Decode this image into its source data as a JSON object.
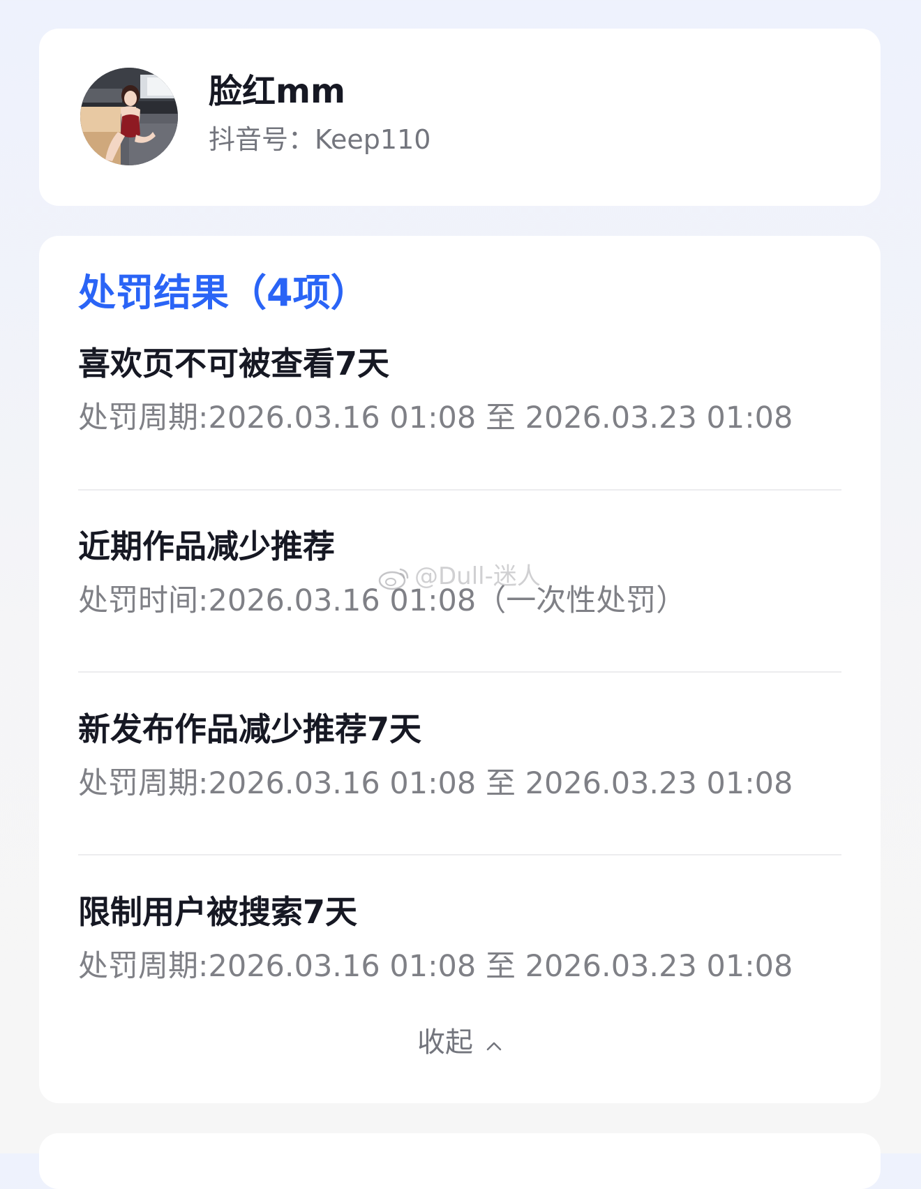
{
  "profile": {
    "nickname": "脸红mm",
    "douyin_id": "抖音号：Keep110",
    "avatar": "avatar-photo"
  },
  "penalty": {
    "title": "处罚结果（4项）",
    "items": [
      {
        "title": "喜欢页不可被查看7天",
        "detail": "处罚周期:2026.03.16 01:08 至 2026.03.23 01:08"
      },
      {
        "title": "近期作品减少推荐",
        "detail": "处罚时间:2026.03.16 01:08（一次性处罚）"
      },
      {
        "title": "新发布作品减少推荐7天",
        "detail": "处罚周期:2026.03.16 01:08 至 2026.03.23 01:08"
      },
      {
        "title": "限制用户被搜索7天",
        "detail": "处罚周期:2026.03.16 01:08 至 2026.03.23 01:08"
      }
    ],
    "collapse_label": "收起",
    "collapse_icon": "chevron-up-icon"
  },
  "watermark": {
    "text": "@Dull-迷人",
    "icon": "weibo-icon"
  },
  "colors": {
    "accent": "#2a64f6",
    "title_text": "#161823",
    "secondary_text": "#7f8086",
    "card_bg": "#ffffff",
    "page_bg": "#eef2fd"
  }
}
